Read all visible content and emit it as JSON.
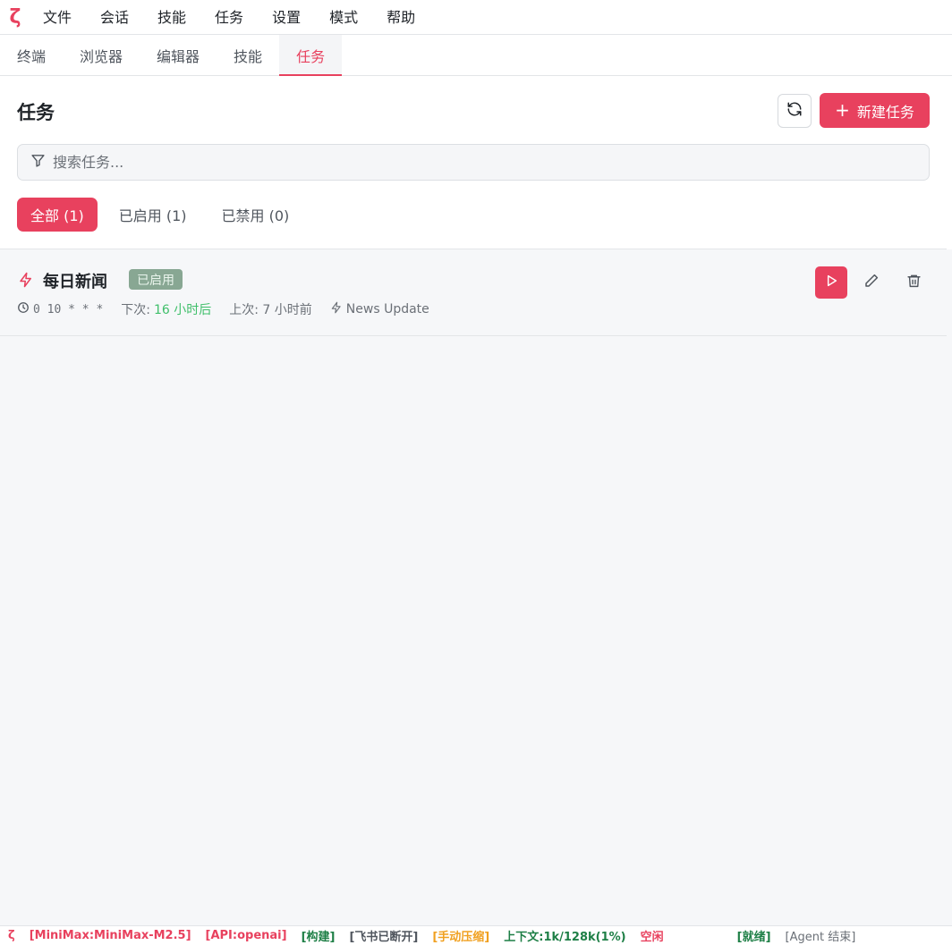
{
  "app": {
    "logo": "ζ",
    "menu": [
      "文件",
      "会话",
      "技能",
      "任务",
      "设置",
      "模式",
      "帮助"
    ]
  },
  "tabs": [
    {
      "label": "终端",
      "active": false
    },
    {
      "label": "浏览器",
      "active": false
    },
    {
      "label": "编辑器",
      "active": false
    },
    {
      "label": "技能",
      "active": false
    },
    {
      "label": "任务",
      "active": true
    }
  ],
  "header": {
    "title": "任务",
    "refresh_icon": "refresh-icon",
    "new_button": {
      "icon": "+",
      "label": "新建任务"
    }
  },
  "search": {
    "placeholder": "搜索任务...",
    "value": "",
    "icon": "filter-icon"
  },
  "filters": [
    {
      "label": "全部 (1)",
      "active": true
    },
    {
      "label": "已启用 (1)",
      "active": false
    },
    {
      "label": "已禁用 (0)",
      "active": false
    }
  ],
  "tasks": [
    {
      "name": "每日新闻",
      "status": "已启用",
      "cron": "0 10 * * *",
      "next_label": "下次:",
      "next_value": "16 小时后",
      "last": "上次: 7 小时前",
      "skill": "News Update"
    }
  ],
  "status_bar": {
    "logo": "ζ",
    "items": [
      {
        "text": "[MiniMax:MiniMax-M2.5]",
        "color": "#e8415e"
      },
      {
        "text": "[API:openai]",
        "color": "#e8415e"
      },
      {
        "text": "[构建]",
        "color": "#1e7f46"
      },
      {
        "text": "[飞书已断开]",
        "color": "#6b7077"
      },
      {
        "text": "[手动压缩]",
        "color": "#f0a020"
      },
      {
        "text": "上下文:1k/128k(1%)",
        "color": "#1e7f46"
      },
      {
        "text": "空闲",
        "color": "#e8415e"
      },
      {
        "text": "[就绪]",
        "color": "#1e7f46"
      },
      {
        "text": "[Agent 结束]",
        "color": "#6b7077"
      }
    ]
  }
}
